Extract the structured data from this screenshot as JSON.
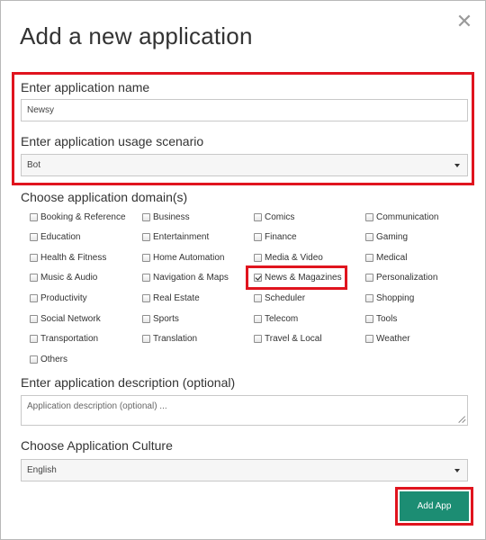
{
  "dialog": {
    "title": "Add a new application",
    "close_glyph": "✕",
    "close_icon": "close-icon"
  },
  "app_name": {
    "label": "Enter application name",
    "value": "Newsy"
  },
  "usage_scenario": {
    "label": "Enter application usage scenario",
    "value": "Bot"
  },
  "domains": {
    "label": "Choose application domain(s)",
    "items": [
      {
        "label": "Booking & Reference",
        "checked": false
      },
      {
        "label": "Business",
        "checked": false
      },
      {
        "label": "Comics",
        "checked": false
      },
      {
        "label": "Communication",
        "checked": false
      },
      {
        "label": "Education",
        "checked": false
      },
      {
        "label": "Entertainment",
        "checked": false
      },
      {
        "label": "Finance",
        "checked": false
      },
      {
        "label": "Gaming",
        "checked": false
      },
      {
        "label": "Health & Fitness",
        "checked": false
      },
      {
        "label": "Home Automation",
        "checked": false
      },
      {
        "label": "Media & Video",
        "checked": false
      },
      {
        "label": "Medical",
        "checked": false
      },
      {
        "label": "Music & Audio",
        "checked": false
      },
      {
        "label": "Navigation & Maps",
        "checked": false
      },
      {
        "label": "News & Magazines",
        "checked": true
      },
      {
        "label": "Personalization",
        "checked": false
      },
      {
        "label": "Productivity",
        "checked": false
      },
      {
        "label": "Real Estate",
        "checked": false
      },
      {
        "label": "Scheduler",
        "checked": false
      },
      {
        "label": "Shopping",
        "checked": false
      },
      {
        "label": "Social Network",
        "checked": false
      },
      {
        "label": "Sports",
        "checked": false
      },
      {
        "label": "Telecom",
        "checked": false
      },
      {
        "label": "Tools",
        "checked": false
      },
      {
        "label": "Transportation",
        "checked": false
      },
      {
        "label": "Translation",
        "checked": false
      },
      {
        "label": "Travel & Local",
        "checked": false
      },
      {
        "label": "Weather",
        "checked": false
      },
      {
        "label": "Others",
        "checked": false
      }
    ]
  },
  "description": {
    "label": "Enter application description (optional)",
    "placeholder": "Application description (optional) ..."
  },
  "culture": {
    "label": "Choose Application Culture",
    "value": "English"
  },
  "actions": {
    "add_label": "Add App"
  },
  "colors": {
    "highlight": "#e0141e",
    "primary_button": "#1c8d73"
  }
}
